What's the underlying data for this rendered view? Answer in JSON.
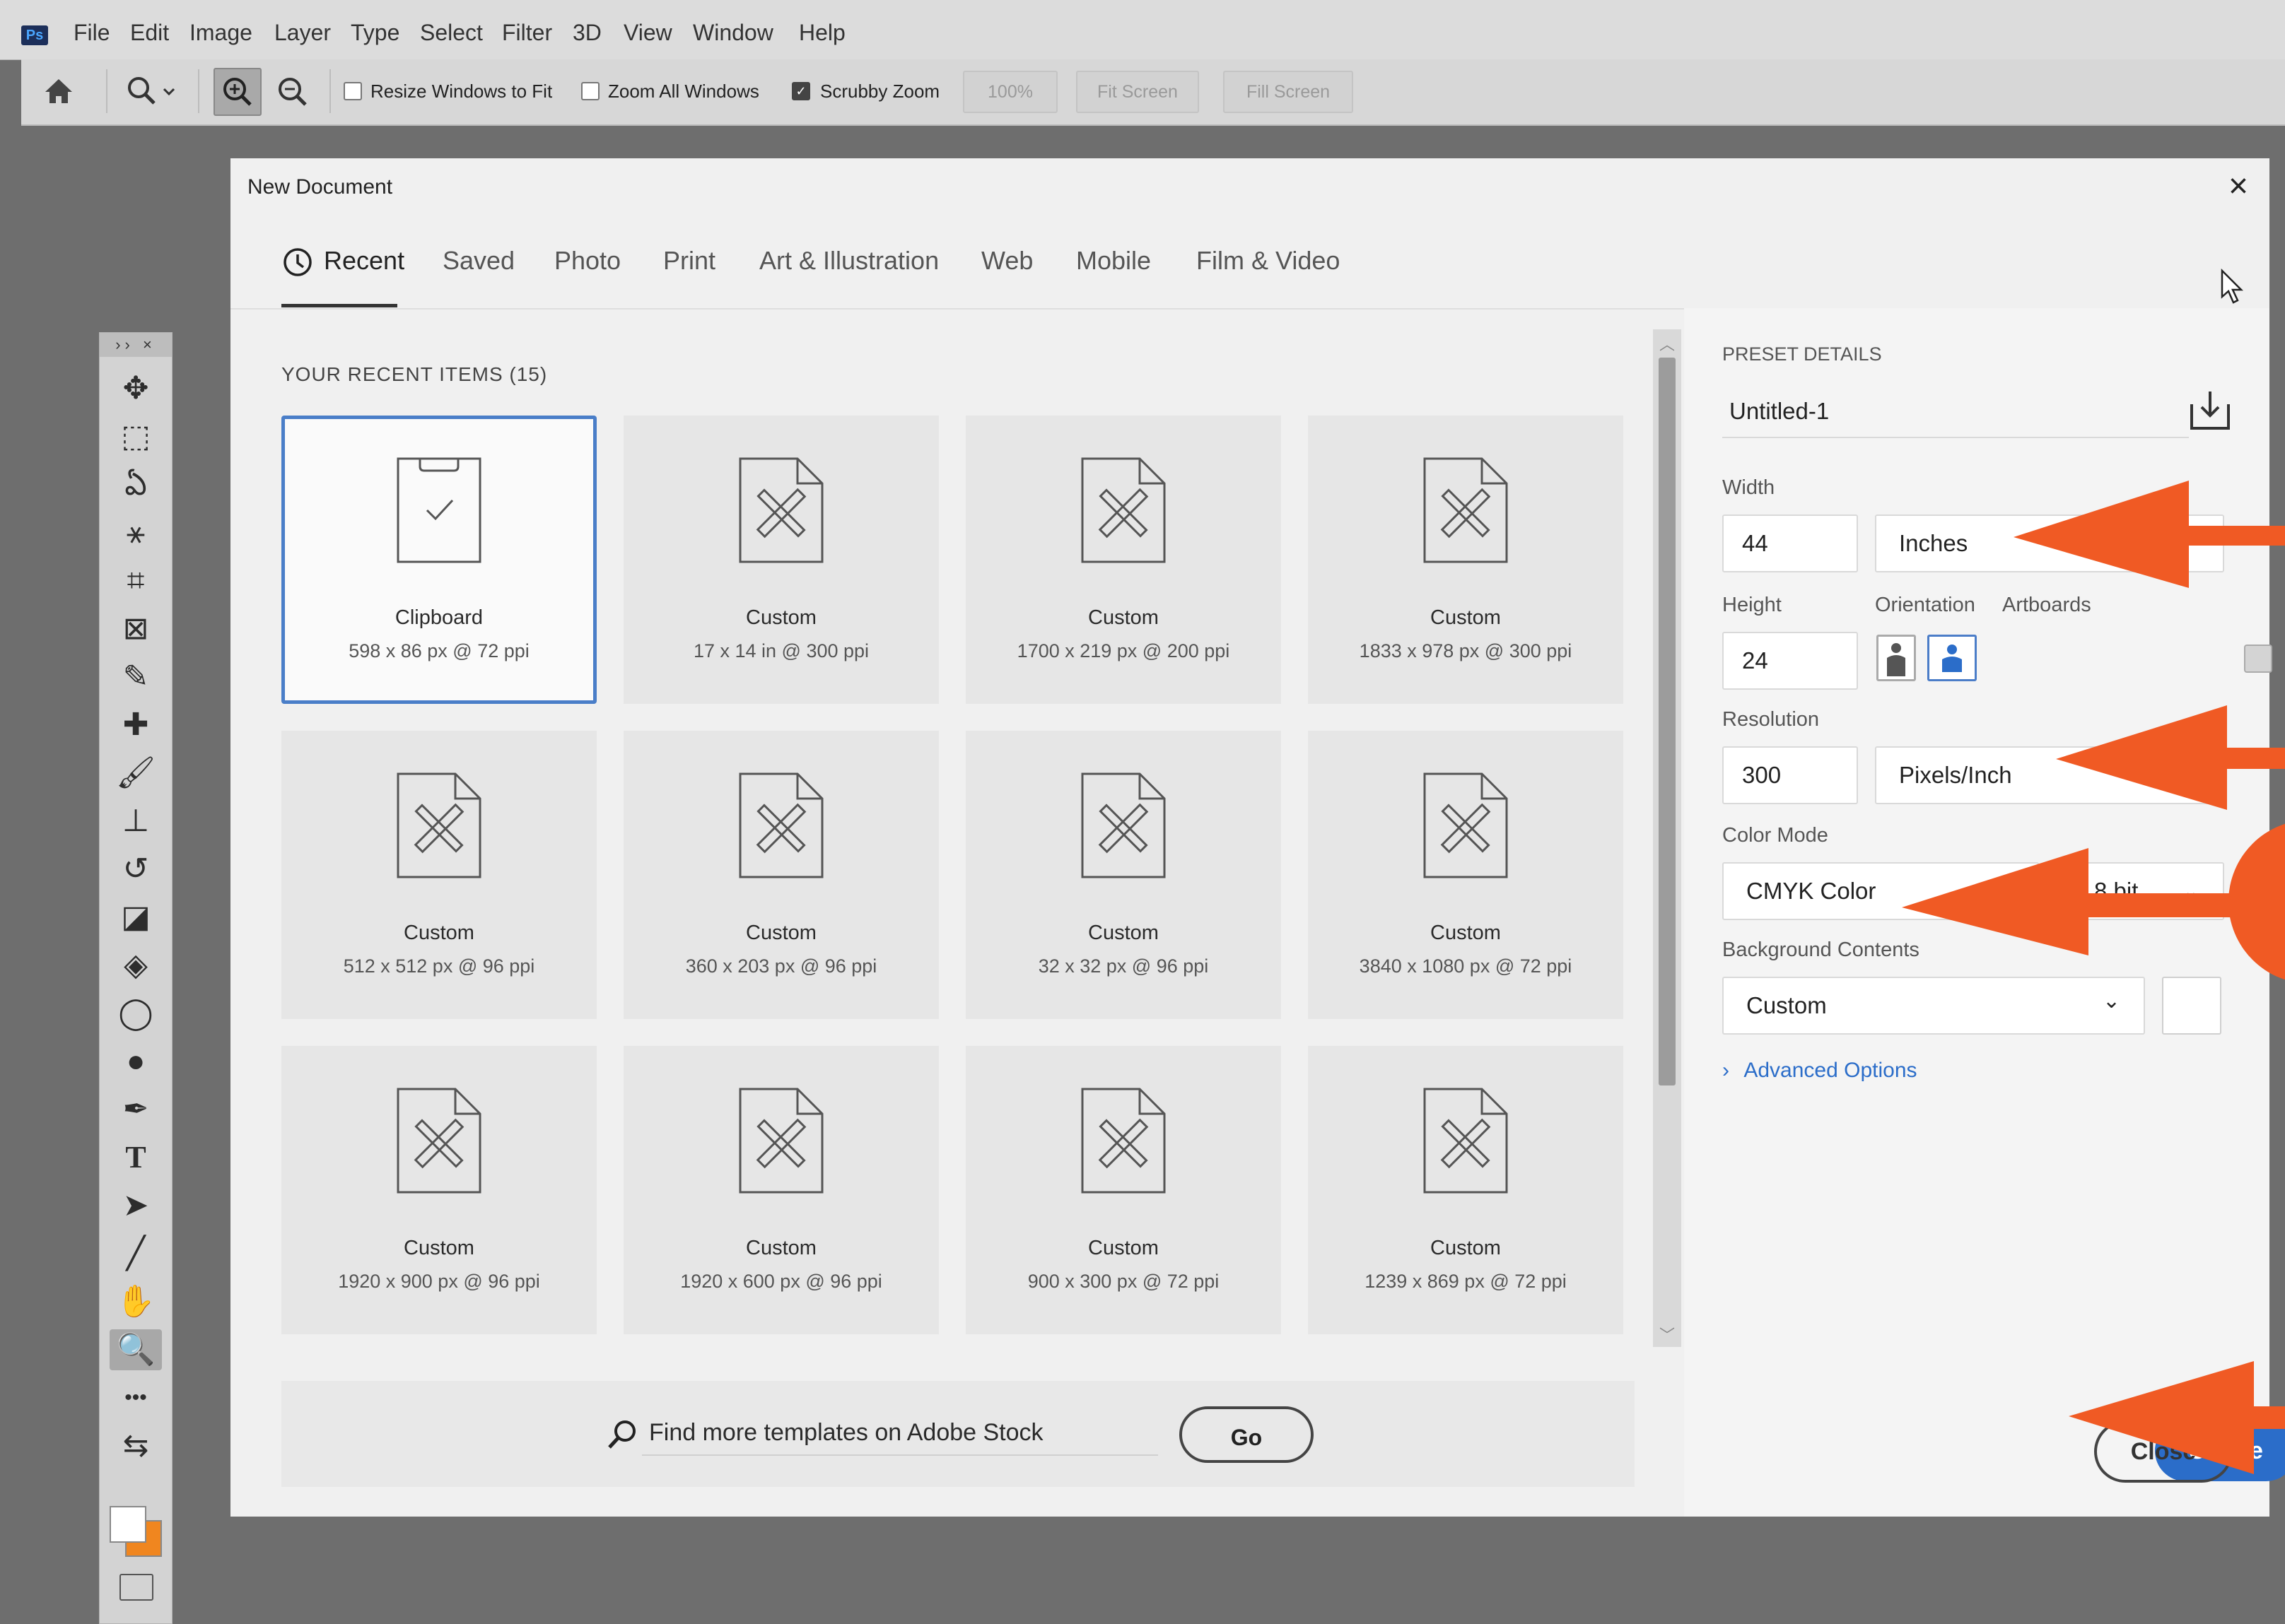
{
  "app": {
    "logo_text": "Ps",
    "menu": [
      "File",
      "Edit",
      "Image",
      "Layer",
      "Type",
      "Select",
      "Filter",
      "3D",
      "View",
      "Window",
      "Help"
    ]
  },
  "options_bar": {
    "home_icon": "home-icon",
    "zoom_tool_icon": "zoom-icon",
    "zoom_in_icon": "zoom-in-icon",
    "zoom_out_icon": "zoom-out-icon",
    "resize_windows_label": "Resize Windows to Fit",
    "resize_windows_checked": false,
    "zoom_all_label": "Zoom All Windows",
    "zoom_all_checked": false,
    "scrubby_zoom_label": "Scrubby Zoom",
    "scrubby_zoom_checked": true,
    "zoom_100_label": "100%",
    "fit_screen_label": "Fit Screen",
    "fill_screen_label": "Fill Screen"
  },
  "toolbar": {
    "header": "›› ×",
    "tools": [
      {
        "icon": "move-icon",
        "glyph": "✥"
      },
      {
        "icon": "marquee-icon",
        "glyph": "⬚"
      },
      {
        "icon": "lasso-icon",
        "glyph": "ఏ"
      },
      {
        "icon": "magic-wand-icon",
        "glyph": "⚹"
      },
      {
        "icon": "crop-icon",
        "glyph": "⌗"
      },
      {
        "icon": "frame-icon",
        "glyph": "⊠"
      },
      {
        "icon": "eyedropper-icon",
        "glyph": "✎"
      },
      {
        "icon": "healing-brush-icon",
        "glyph": "✚"
      },
      {
        "icon": "brush-icon",
        "glyph": "🖌"
      },
      {
        "icon": "stamp-icon",
        "glyph": "⊥"
      },
      {
        "icon": "history-brush-icon",
        "glyph": "↺"
      },
      {
        "icon": "eraser-icon",
        "glyph": "◪"
      },
      {
        "icon": "paint-bucket-icon",
        "glyph": "◈"
      },
      {
        "icon": "blur-icon",
        "glyph": "◯"
      },
      {
        "icon": "dodge-icon",
        "glyph": "●"
      },
      {
        "icon": "pen-icon",
        "glyph": "✒"
      },
      {
        "icon": "type-icon",
        "glyph": "T"
      },
      {
        "icon": "path-selection-icon",
        "glyph": "➤"
      },
      {
        "icon": "line-icon",
        "glyph": "╱"
      },
      {
        "icon": "hand-icon",
        "glyph": "✋"
      },
      {
        "icon": "zoom-tool-icon",
        "glyph": "🔍",
        "active": true
      },
      {
        "icon": "more-tools-icon",
        "glyph": "•••"
      },
      {
        "icon": "swap-colors-icon",
        "glyph": "⇆"
      }
    ],
    "foreground_color": "#ffffff",
    "background_color": "#f0861f"
  },
  "dialog": {
    "title": "New Document",
    "tabs": [
      "Recent",
      "Saved",
      "Photo",
      "Print",
      "Art & Illustration",
      "Web",
      "Mobile",
      "Film & Video"
    ],
    "active_tab": "Recent",
    "recent_heading": "YOUR RECENT ITEMS  (15)",
    "items": [
      {
        "name": "Clipboard",
        "detail": "598 x 86 px @ 72 ppi",
        "icon": "clipboard-icon",
        "selected": true
      },
      {
        "name": "Custom",
        "detail": "17 x 14 in @ 300 ppi",
        "icon": "document-tools-icon"
      },
      {
        "name": "Custom",
        "detail": "1700 x 219 px @ 200 ppi",
        "icon": "document-tools-icon"
      },
      {
        "name": "Custom",
        "detail": "1833 x 978 px @ 300 ppi",
        "icon": "document-tools-icon"
      },
      {
        "name": "Custom",
        "detail": "512 x 512 px @ 96 ppi",
        "icon": "document-tools-icon"
      },
      {
        "name": "Custom",
        "detail": "360 x 203 px @ 96 ppi",
        "icon": "document-tools-icon"
      },
      {
        "name": "Custom",
        "detail": "32 x 32 px @ 96 ppi",
        "icon": "document-tools-icon"
      },
      {
        "name": "Custom",
        "detail": "3840 x 1080 px @ 72 ppi",
        "icon": "document-tools-icon"
      },
      {
        "name": "Custom",
        "detail": "1920 x 900 px @ 96 ppi",
        "icon": "document-tools-icon"
      },
      {
        "name": "Custom",
        "detail": "1920 x 600 px @ 96 ppi",
        "icon": "document-tools-icon"
      },
      {
        "name": "Custom",
        "detail": "900 x 300 px @ 72 ppi",
        "icon": "document-tools-icon"
      },
      {
        "name": "Custom",
        "detail": "1239 x 869 px @ 72 ppi",
        "icon": "document-tools-icon"
      }
    ],
    "stock_search_text": "Find more templates on Adobe Stock",
    "go_label": "Go",
    "preset": {
      "heading": "PRESET DETAILS",
      "name": "Untitled-1",
      "width_label": "Width",
      "width_value": "44",
      "width_unit": "Inches",
      "height_label": "Height",
      "height_value": "24",
      "orientation_label": "Orientation",
      "artboards_label": "Artboards",
      "artboards_checked": false,
      "resolution_label": "Resolution",
      "resolution_value": "300",
      "resolution_unit": "Pixels/Inch",
      "color_mode_label": "Color Mode",
      "color_mode": "CMYK Color",
      "bit_depth": "8 bit",
      "background_label": "Background Contents",
      "background_value": "Custom",
      "background_swatch": "#ffffff",
      "advanced_label": "Advanced Options"
    },
    "create_label": "Create",
    "close_label": "Close"
  },
  "colors": {
    "accent": "#2b6dc9",
    "annotation_arrow": "#f05a24"
  }
}
